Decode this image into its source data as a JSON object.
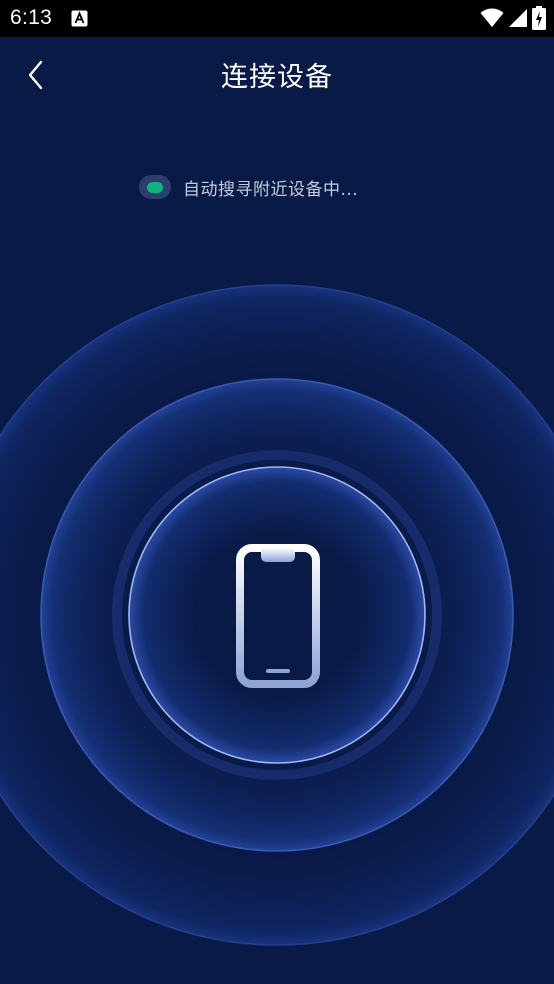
{
  "status_bar": {
    "time": "6:13",
    "icons": [
      "text-a-icon",
      "wifi-icon",
      "signal-icon",
      "battery-charging-icon"
    ]
  },
  "header": {
    "back_icon": "chevron-left-icon",
    "title": "连接设备"
  },
  "search": {
    "indicator_icon": "green-status-dot",
    "text": "自动搜寻附近设备中..."
  },
  "radar": {
    "center_icon": "phone-icon"
  },
  "colors": {
    "background": "#0a1a47",
    "status_bar": "#000000",
    "indicator": "#10b282",
    "ring_inner": "#8aa7e8",
    "ring_middle": "#3f5fb2",
    "ring_outer": "#2a4596"
  }
}
